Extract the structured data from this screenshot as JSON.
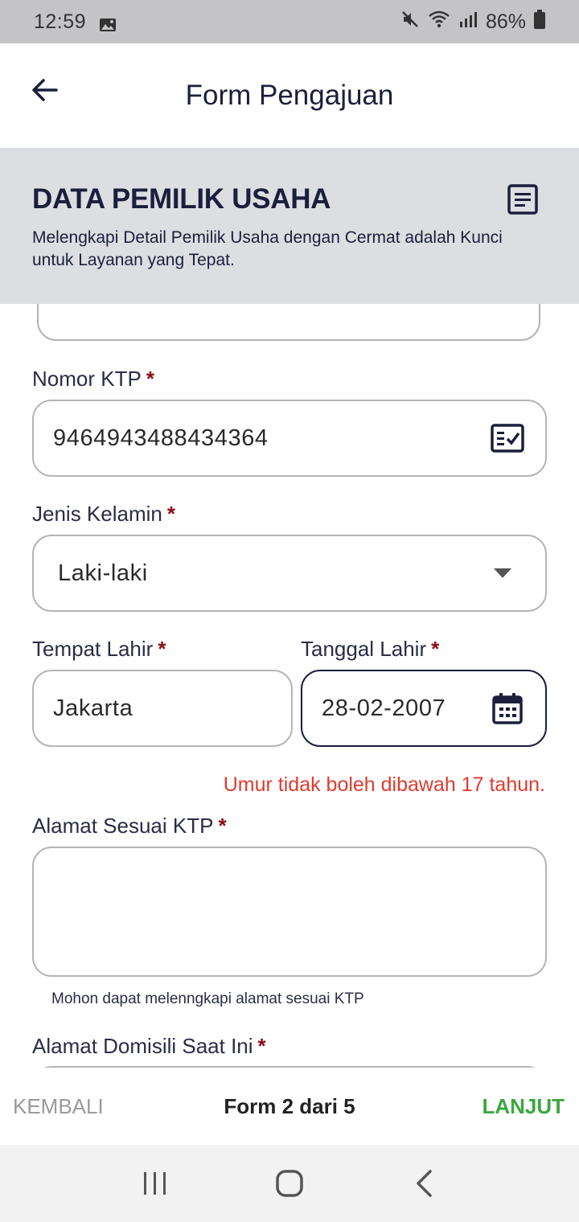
{
  "status_bar": {
    "time": "12:59",
    "battery": "86%"
  },
  "app_bar": {
    "title": "Form Pengajuan"
  },
  "section": {
    "title": "DATA PEMILIK USAHA",
    "description": "Melengkapi Detail Pemilik Usaha dengan Cermat adalah Kunci untuk Layanan yang Tepat."
  },
  "form": {
    "ktp": {
      "label": "Nomor KTP",
      "required_mark": "*",
      "value": "9464943488434364"
    },
    "gender": {
      "label": "Jenis Kelamin",
      "required_mark": "*",
      "value": "Laki-laki"
    },
    "birth_place": {
      "label": "Tempat Lahir",
      "required_mark": "*",
      "value": "Jakarta"
    },
    "birth_date": {
      "label": "Tanggal Lahir",
      "required_mark": "*",
      "value": "28-02-2007",
      "error": "Umur tidak boleh dibawah 17 tahun."
    },
    "ktp_address": {
      "label": "Alamat Sesuai KTP",
      "required_mark": "*",
      "value": "",
      "helper": "Mohon dapat melenngkapi alamat sesuai KTP"
    },
    "domicile_address": {
      "label": "Alamat Domisili Saat Ini",
      "required_mark": "*"
    }
  },
  "bottom_nav": {
    "back_label": "KEMBALI",
    "progress": "Form 2 dari 5",
    "next_label": "LANJUT"
  },
  "colors": {
    "primary": "#1b1f3b",
    "error": "#e23a2e",
    "required": "#8b0b13",
    "next": "#3aa83d",
    "header_bg": "#dddee2"
  }
}
